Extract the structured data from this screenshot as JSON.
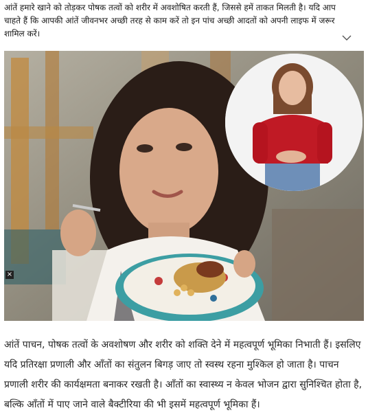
{
  "intro": {
    "text": "आंतें हमारे खाने को तोड़कर पोषक तत्वों को शरीर में अवशोषित करती हैं, जिससे हमें ताकत मिलती है। यदि आप चाहते हैं कि आपकी आंतें जीवनभर अच्छी तरह से काम करें तो इन पांच अच्छी आदतों को अपनी लाइफ में जरूर शामिल करें।"
  },
  "expand_icon": "chevron-down-icon",
  "hero": {
    "close_label": "×",
    "close_icon": "close-icon"
  },
  "article": {
    "text": "आंतें पाचन, पोषक तत्वों के अवशोषण और शरीर को शक्ति देने में महत्वपूर्ण भूमिका निभाती हैं। इसलिए यदि प्रतिरक्षा प्रणाली और आँतों का संतुलन बिगड़ जाए तो स्वस्थ रहना मुश्किल हो जाता है। पाचन प्रणाली शरीर की कार्यक्षमता बनाकर रखती है। आँतों का स्वास्थ्य न केवल भोजन द्वारा सुनिश्चित होता है, बल्कि आँतों में पाए जाने वाले बैक्टीरिया की भी इसमें महत्वपूर्ण भूमिका हैं।"
  }
}
